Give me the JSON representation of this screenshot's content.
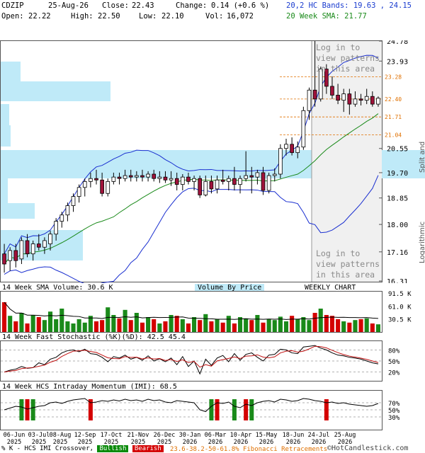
{
  "header": {
    "ticker": "CDZIP",
    "date": "25-Aug-26",
    "close_label": "Close:",
    "close": "22.43",
    "change_label": "Change:",
    "change": "0.14 (+0.6 %)",
    "open_label": "Open:",
    "open": "22.22",
    "high_label": "High:",
    "high": "22.50",
    "low_label": "Low:",
    "low": "22.10",
    "vol_label": "Vol:",
    "vol": "16,072",
    "bands": "20,2 HC Bands: 19.63 , 24.15",
    "sma": "20 Week SMA: 21.77"
  },
  "side_labels": {
    "adjusted": "Split and Dividend Adjusted",
    "scale": "Logarithmic"
  },
  "watermark": {
    "line1": "Log in to",
    "line2": "view patterns",
    "line3": "in this area"
  },
  "volume_panel": {
    "title": "14 Week SMA Volume: 30.6 K",
    "vbp_label": "Volume By Price",
    "chart_label": "WEEKLY CHART",
    "y_labels": [
      "91.5 K",
      "61.0 K",
      "30.5 K"
    ]
  },
  "stoch_panel": {
    "title": "14 Week Fast Stochastic (%K)(%D): 42.5 45.4",
    "y_labels": [
      "80%",
      "50%",
      "20%"
    ]
  },
  "imi_panel": {
    "title": "14 Week HCS Intraday Momentum (IMI): 68.5",
    "y_labels": [
      "70%",
      "50%",
      "30%"
    ]
  },
  "footer": {
    "legend_prefix": "% K - HCS IMI Crossover,",
    "bullish": "Bullish",
    "bearish": "Bearish",
    "fibo": "23.6-38.2-50-61.8% Fibonacci Retracements",
    "credit": "©HotCandlestick.com"
  },
  "colors": {
    "up": "#1a8a1a",
    "down": "#d40000",
    "band": "#1a2fd0",
    "sma": "#1a8a1a",
    "vbp": "#bfeaf8",
    "fib": "#e07000"
  },
  "chart_data": {
    "type": "candlestick",
    "title": "CDZIP",
    "scale": "log",
    "price_axis_ticks": [
      24.78,
      23.93,
      23.28,
      22.4,
      21.71,
      21.04,
      20.55,
      19.7,
      18.85,
      18.0,
      17.16,
      16.31
    ],
    "fib_levels": [
      23.28,
      22.4,
      21.71,
      21.04
    ],
    "x_tick_labels": [
      "06-Jun 2025",
      "03-Jul 2025",
      "08-Aug 2025",
      "12-Sep 2025",
      "17-Oct 2025",
      "21-Nov 2025",
      "26-Dec 2025",
      "30-Jan 2026",
      "06-Mar 2026",
      "10-Apr 2026",
      "15-May 2026",
      "18-Jun 2026",
      "24-Jul 2026",
      "25-Aug 2026"
    ],
    "candles": [
      {
        "o": 17.1,
        "h": 17.4,
        "l": 16.55,
        "c": 16.8
      },
      {
        "o": 16.9,
        "h": 17.3,
        "l": 16.6,
        "c": 17.2
      },
      {
        "o": 17.2,
        "h": 17.4,
        "l": 16.7,
        "c": 16.9
      },
      {
        "o": 16.95,
        "h": 17.6,
        "l": 16.8,
        "c": 17.5
      },
      {
        "o": 17.5,
        "h": 17.7,
        "l": 17.0,
        "c": 17.1
      },
      {
        "o": 17.1,
        "h": 17.5,
        "l": 16.9,
        "c": 17.4
      },
      {
        "o": 17.4,
        "h": 17.7,
        "l": 17.2,
        "c": 17.3
      },
      {
        "o": 17.3,
        "h": 17.6,
        "l": 17.1,
        "c": 17.5
      },
      {
        "o": 17.4,
        "h": 17.8,
        "l": 17.2,
        "c": 17.7
      },
      {
        "o": 17.7,
        "h": 18.2,
        "l": 17.5,
        "c": 18.1
      },
      {
        "o": 18.1,
        "h": 18.4,
        "l": 17.9,
        "c": 18.3
      },
      {
        "o": 18.3,
        "h": 18.7,
        "l": 18.1,
        "c": 18.6
      },
      {
        "o": 18.6,
        "h": 19.0,
        "l": 18.4,
        "c": 18.9
      },
      {
        "o": 18.9,
        "h": 19.3,
        "l": 18.7,
        "c": 19.2
      },
      {
        "o": 19.2,
        "h": 19.5,
        "l": 18.9,
        "c": 19.4
      },
      {
        "o": 19.4,
        "h": 19.7,
        "l": 19.2,
        "c": 19.5
      },
      {
        "o": 19.5,
        "h": 19.8,
        "l": 19.3,
        "c": 19.45
      },
      {
        "o": 19.45,
        "h": 19.7,
        "l": 18.9,
        "c": 19.0
      },
      {
        "o": 19.0,
        "h": 19.5,
        "l": 18.9,
        "c": 19.4
      },
      {
        "o": 19.4,
        "h": 19.7,
        "l": 19.3,
        "c": 19.55
      },
      {
        "o": 19.55,
        "h": 19.7,
        "l": 19.3,
        "c": 19.5
      },
      {
        "o": 19.5,
        "h": 19.8,
        "l": 19.4,
        "c": 19.6
      },
      {
        "o": 19.6,
        "h": 19.8,
        "l": 19.4,
        "c": 19.55
      },
      {
        "o": 19.55,
        "h": 19.75,
        "l": 19.4,
        "c": 19.6
      },
      {
        "o": 19.6,
        "h": 19.8,
        "l": 19.4,
        "c": 19.55
      },
      {
        "o": 19.55,
        "h": 19.75,
        "l": 19.4,
        "c": 19.65
      },
      {
        "o": 19.65,
        "h": 19.8,
        "l": 19.4,
        "c": 19.5
      },
      {
        "o": 19.5,
        "h": 19.75,
        "l": 19.35,
        "c": 19.55
      },
      {
        "o": 19.55,
        "h": 19.75,
        "l": 19.35,
        "c": 19.45
      },
      {
        "o": 19.45,
        "h": 19.75,
        "l": 19.25,
        "c": 19.5
      },
      {
        "o": 19.5,
        "h": 19.7,
        "l": 19.1,
        "c": 19.3
      },
      {
        "o": 19.3,
        "h": 19.65,
        "l": 19.1,
        "c": 19.55
      },
      {
        "o": 19.55,
        "h": 19.7,
        "l": 19.3,
        "c": 19.4
      },
      {
        "o": 19.4,
        "h": 19.6,
        "l": 19.1,
        "c": 19.5
      },
      {
        "o": 19.5,
        "h": 19.6,
        "l": 18.85,
        "c": 18.95
      },
      {
        "o": 18.95,
        "h": 19.6,
        "l": 18.9,
        "c": 19.4
      },
      {
        "o": 19.4,
        "h": 19.6,
        "l": 19.0,
        "c": 19.15
      },
      {
        "o": 19.15,
        "h": 19.6,
        "l": 19.0,
        "c": 19.45
      },
      {
        "o": 19.45,
        "h": 19.8,
        "l": 19.3,
        "c": 19.4
      },
      {
        "o": 19.4,
        "h": 19.6,
        "l": 19.1,
        "c": 19.5
      },
      {
        "o": 19.5,
        "h": 19.9,
        "l": 19.1,
        "c": 19.3
      },
      {
        "o": 19.3,
        "h": 19.6,
        "l": 19.0,
        "c": 19.5
      },
      {
        "o": 19.5,
        "h": 20.45,
        "l": 19.4,
        "c": 19.6
      },
      {
        "o": 19.6,
        "h": 19.9,
        "l": 19.0,
        "c": 19.55
      },
      {
        "o": 19.55,
        "h": 19.8,
        "l": 19.3,
        "c": 19.7
      },
      {
        "o": 19.7,
        "h": 19.9,
        "l": 18.95,
        "c": 19.1
      },
      {
        "o": 19.1,
        "h": 19.7,
        "l": 19.0,
        "c": 19.6
      },
      {
        "o": 19.6,
        "h": 19.85,
        "l": 19.4,
        "c": 19.65
      },
      {
        "o": 19.65,
        "h": 20.7,
        "l": 19.5,
        "c": 20.55
      },
      {
        "o": 20.55,
        "h": 20.9,
        "l": 20.3,
        "c": 20.7
      },
      {
        "o": 20.7,
        "h": 20.95,
        "l": 20.3,
        "c": 20.4
      },
      {
        "o": 20.4,
        "h": 20.8,
        "l": 20.2,
        "c": 20.6
      },
      {
        "o": 20.6,
        "h": 22.1,
        "l": 20.5,
        "c": 21.95
      },
      {
        "o": 21.95,
        "h": 22.85,
        "l": 21.6,
        "c": 22.75
      },
      {
        "o": 22.75,
        "h": 24.78,
        "l": 22.1,
        "c": 22.4
      },
      {
        "o": 22.4,
        "h": 23.7,
        "l": 22.3,
        "c": 23.6
      },
      {
        "o": 23.6,
        "h": 23.8,
        "l": 22.6,
        "c": 22.9
      },
      {
        "o": 22.9,
        "h": 23.3,
        "l": 22.4,
        "c": 22.55
      },
      {
        "o": 22.55,
        "h": 23.0,
        "l": 22.2,
        "c": 22.35
      },
      {
        "o": 22.35,
        "h": 22.8,
        "l": 21.9,
        "c": 22.6
      },
      {
        "o": 22.6,
        "h": 22.8,
        "l": 21.8,
        "c": 22.2
      },
      {
        "o": 22.2,
        "h": 22.7,
        "l": 22.1,
        "c": 22.4
      },
      {
        "o": 22.4,
        "h": 22.6,
        "l": 22.15,
        "c": 22.35
      },
      {
        "o": 22.35,
        "h": 22.8,
        "l": 22.2,
        "c": 22.5
      },
      {
        "o": 22.5,
        "h": 22.7,
        "l": 22.1,
        "c": 22.2
      },
      {
        "o": 22.2,
        "h": 22.5,
        "l": 22.1,
        "c": 22.43
      }
    ]
  }
}
